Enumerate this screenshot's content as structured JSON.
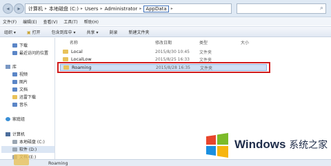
{
  "address_bar": {
    "crumbs": [
      "计算机",
      "本地磁盘 (C:)",
      "Users",
      "Administrator",
      "AppData"
    ]
  },
  "menu_bar": {
    "items": [
      "文件(F)",
      "编辑(E)",
      "查看(V)",
      "工具(T)",
      "帮助(H)"
    ]
  },
  "toolbar": {
    "items": [
      "组织 ▾",
      "打开",
      "包含到库中 ▾",
      "共享 ▾",
      "刻录",
      "新建文件夹"
    ]
  },
  "nav_pane": {
    "favorites": [
      "下载",
      "最近访问的位置"
    ],
    "library_title": "库",
    "libraries": [
      "视频",
      "图片",
      "文档",
      "迅雷下载",
      "音乐"
    ],
    "homegroup": "家庭组",
    "computer_title": "计算机",
    "drives": [
      "本地磁盘 (C:)",
      "软件 (D:)",
      "文档 (E:)"
    ]
  },
  "columns": {
    "name": "名称",
    "date": "修改日期",
    "type": "类型",
    "size": "大小"
  },
  "files": [
    {
      "name": "Local",
      "date": "2015/8/30 10:45",
      "type": "文件夹"
    },
    {
      "name": "LocalLow",
      "date": "2015/8/25 16:33",
      "type": "文件夹"
    },
    {
      "name": "Roaming",
      "date": "2015/8/28 16:35",
      "type": "文件夹"
    }
  ],
  "status_bar": {
    "selected_name": "Roaming"
  },
  "watermark": {
    "brand": "Windows",
    "cn": "系统之家"
  },
  "colors": {
    "highlight_outline": "#d11b1b",
    "selection_fill": "#cfe0f5"
  }
}
